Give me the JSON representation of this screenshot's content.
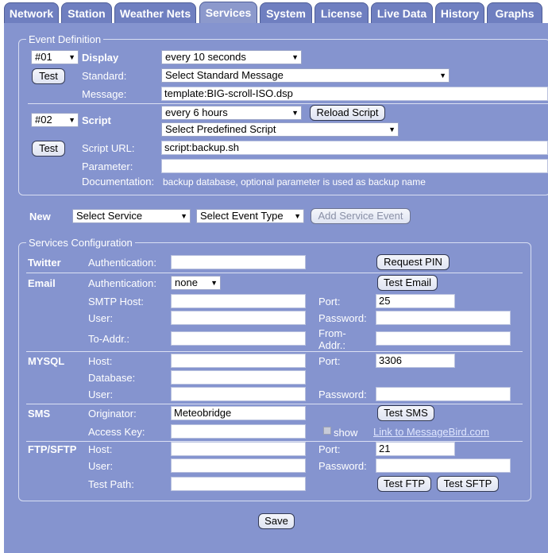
{
  "tabs": [
    "Network",
    "Station",
    "Weather Nets",
    "Services",
    "System",
    "License",
    "Live Data",
    "History",
    "Graphs"
  ],
  "event_definition": {
    "legend": "Event Definition",
    "event1": {
      "number": "#01",
      "type_label": "Display",
      "interval": "every 10 seconds",
      "test_label": "Test",
      "standard_label": "Standard:",
      "standard_value": "Select Standard Message",
      "message_label": "Message:",
      "message_value": "template:BIG-scroll-ISO.dsp"
    },
    "event2": {
      "number": "#02",
      "type_label": "Script",
      "interval": "every 6 hours",
      "reload_label": "Reload Script",
      "predefined_value": "Select Predefined Script",
      "test_label": "Test",
      "url_label": "Script URL:",
      "url_value": "script:backup.sh",
      "parameter_label": "Parameter:",
      "parameter_value": "",
      "documentation_label": "Documentation:",
      "documentation_text": "backup database, optional parameter is used as backup name"
    }
  },
  "new_row": {
    "label": "New",
    "service_select": "Select Service",
    "event_type_select": "Select Event Type",
    "add_button": "Add Service Event"
  },
  "services": {
    "legend": "Services Configuration",
    "twitter": {
      "title": "Twitter",
      "auth_label": "Authentication:",
      "auth_value": "",
      "pin_button": "Request PIN"
    },
    "email": {
      "title": "Email",
      "auth_label": "Authentication:",
      "auth_value": "none",
      "test_button": "Test Email",
      "smtp_label": "SMTP Host:",
      "smtp_value": "",
      "port_label": "Port:",
      "port_value": "25",
      "user_label": "User:",
      "user_value": "",
      "password_label": "Password:",
      "password_value": "",
      "to_label": "To-Addr.:",
      "to_value": "",
      "from_label_1": "From-",
      "from_label_2": "Addr.:",
      "from_value": ""
    },
    "mysql": {
      "title": "MYSQL",
      "host_label": "Host:",
      "host_value": "",
      "port_label": "Port:",
      "port_value": "3306",
      "db_label": "Database:",
      "db_value": "",
      "user_label": "User:",
      "user_value": "",
      "password_label": "Password:",
      "password_value": ""
    },
    "sms": {
      "title": "SMS",
      "originator_label": "Originator:",
      "originator_value": "Meteobridge",
      "test_button": "Test SMS",
      "key_label": "Access Key:",
      "key_value": "",
      "show_label": "show",
      "link_text": "Link to MessageBird.com"
    },
    "ftp": {
      "title": "FTP/SFTP",
      "host_label": "Host:",
      "host_value": "",
      "port_label": "Port:",
      "port_value": "21",
      "user_label": "User:",
      "user_value": "",
      "password_label": "Password:",
      "password_value": "",
      "path_label": "Test Path:",
      "path_value": "",
      "test_ftp": "Test FTP",
      "test_sftp": "Test SFTP"
    }
  },
  "save_label": "Save"
}
